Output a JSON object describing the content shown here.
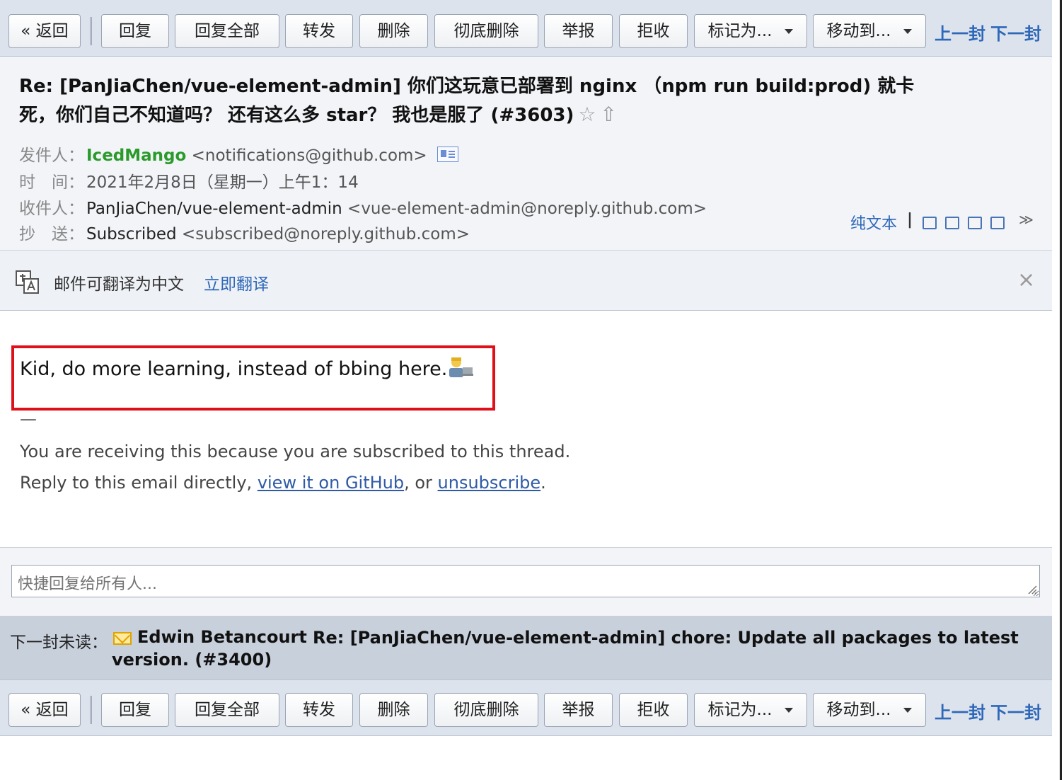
{
  "toolbar": {
    "back": "« 返回",
    "reply": "回复",
    "reply_all": "回复全部",
    "forward": "转发",
    "delete": "删除",
    "delete_permanently": "彻底删除",
    "report": "举报",
    "reject": "拒收",
    "mark_as": "标记为...",
    "move_to": "移动到...",
    "prev": "上一封",
    "next": "下一封"
  },
  "email": {
    "subject": "Re: [PanJiaChen/vue-element-admin] 你们这玩意已部署到 nginx （npm run build:prod) 就卡死，你们自己不知道吗？ 还有这么多 star？ 我也是服了 (#3603)",
    "star_icon": "☆",
    "up_icon": "⇧",
    "from_label": "发件人：",
    "from_name": "IcedMango",
    "from_addr": "<notifications@github.com>",
    "time_label": "时　间：",
    "time_value": "2021年2月8日（星期一）上午1：14",
    "to_label": "收件人：",
    "to_name": "PanJiaChen/vue-element-admin",
    "to_addr": "<vue-element-admin@noreply.github.com>",
    "cc_label": "抄　送：",
    "cc_name": "Subscribed",
    "cc_addr": "<subscribed@noreply.github.com>",
    "plain_text": "纯文本",
    "pipe": "|",
    "collapse_icon": "≫"
  },
  "translate": {
    "text": "邮件可翻译为中文",
    "link": "立即翻译",
    "close": "×"
  },
  "body": {
    "main": "Kid, do more learning, instead of bbing here.",
    "dash": "—",
    "line1": "You are receiving this because you are subscribed to this thread.",
    "line2_prefix": "Reply to this email directly, ",
    "link_github": "view it on GitHub",
    "line2_mid": ", or ",
    "link_unsub": "unsubscribe",
    "line2_end": "."
  },
  "quick_reply": {
    "placeholder": "快捷回复给所有人..."
  },
  "next_unread": {
    "label": "下一封未读：",
    "sender": "Edwin Betancourt",
    "subject": "Re: [PanJiaChen/vue-element-admin] chore: Update all packages to latest version. (#3400)"
  },
  "colors": {
    "accent_link": "#2e68b8",
    "sender_green": "#2b9a2b",
    "highlight_red": "#e0101a"
  }
}
